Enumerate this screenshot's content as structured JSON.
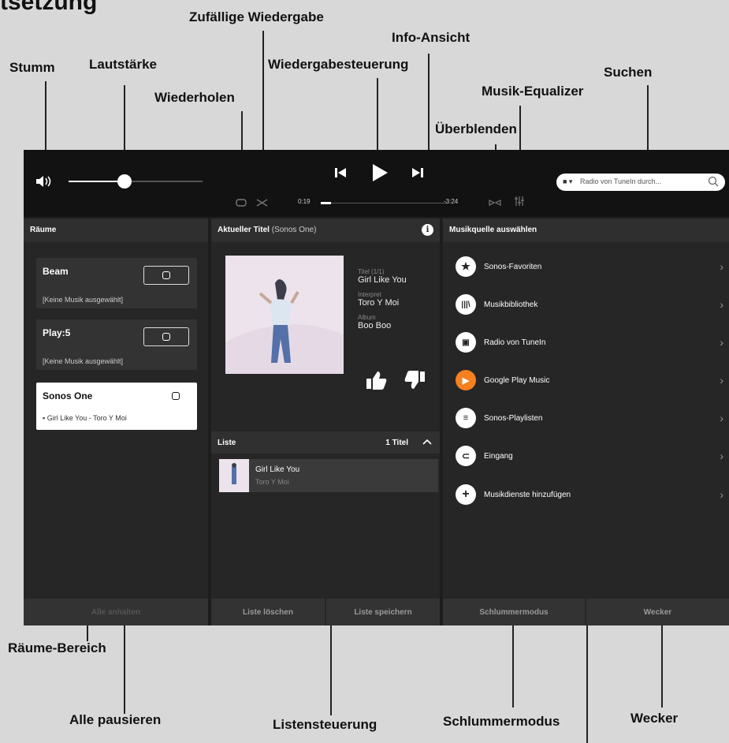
{
  "callouts": {
    "stumm": "Stumm",
    "lautstaerke": "Lautstärke",
    "zufaellige": "Zufällige Wiedergabe",
    "wiederholen": "Wiederholen",
    "info": "Info-Ansicht",
    "wiedergabesteuerung": "Wiedergabesteuerung",
    "suchen": "Suchen",
    "equalizer": "Musik-Equalizer",
    "ueberblenden": "Überblenden",
    "raeume_bereich": "Räume-Bereich",
    "alle_pausieren": "Alle pausieren",
    "listensteuerung": "Listensteuerung",
    "schlummermodus": "Schlummermodus",
    "wecker": "Wecker"
  },
  "player": {
    "time_elapsed": "0:19",
    "time_remaining": "-3:24",
    "volume_level": 0.42,
    "progress": 0.08,
    "search_placeholder": "Radio von TuneIn durch..."
  },
  "rooms": {
    "header": "Räume",
    "items": [
      {
        "name": "Beam",
        "status": "[Keine Musik ausgewählt]"
      },
      {
        "name": "Play:5",
        "status": "[Keine Musik ausgewählt]"
      },
      {
        "name": "Sonos One",
        "status": "Girl Like You - Toro Y Moi"
      }
    ],
    "pause_all": "Alle anhalten"
  },
  "now_playing": {
    "header_title": "Aktueller Titel",
    "header_room": "(Sonos One)",
    "title_label": "Titel (1/1)",
    "title": "Girl Like You",
    "artist_label": "Interpret",
    "artist": "Toro Y Moi",
    "album_label": "Album",
    "album": "Boo Boo"
  },
  "queue": {
    "header": "Liste",
    "count": "1 Titel",
    "items": [
      {
        "title": "Girl Like You",
        "artist": "Toro Y Moi"
      }
    ],
    "clear": "Liste löschen",
    "save": "Liste speichern"
  },
  "sources": {
    "header": "Musikquelle auswählen",
    "items": [
      {
        "label": "Sonos-Favoriten",
        "icon": "star-icon"
      },
      {
        "label": "Musikbibliothek",
        "icon": "library-icon"
      },
      {
        "label": "Radio von TuneIn",
        "icon": "radio-icon"
      },
      {
        "label": "Google Play Music",
        "icon": "google-play-icon"
      },
      {
        "label": "Sonos-Playlisten",
        "icon": "playlist-icon"
      },
      {
        "label": "Eingang",
        "icon": "line-in-icon"
      },
      {
        "label": "Musikdienste hinzufügen",
        "icon": "plus-icon"
      }
    ],
    "sleep": "Schlummermodus",
    "alarm": "Wecker"
  }
}
